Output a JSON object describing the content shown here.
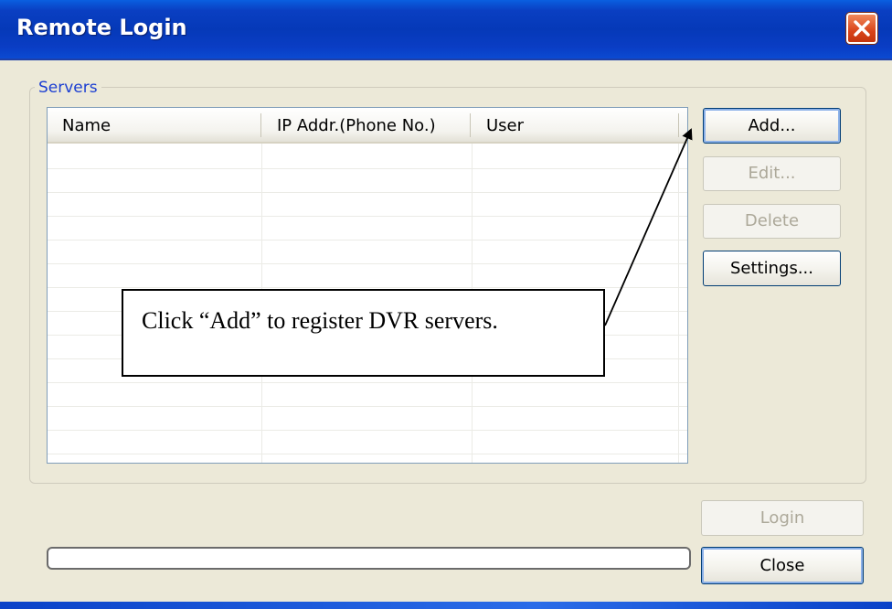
{
  "window": {
    "title": "Remote Login"
  },
  "servers": {
    "legend": "Servers",
    "columns": [
      "Name",
      "IP Addr.(Phone No.)",
      "User"
    ]
  },
  "buttons": {
    "add": "Add...",
    "edit": "Edit...",
    "delete": "Delete",
    "settings": "Settings...",
    "login": "Login",
    "close": "Close"
  },
  "callout": {
    "text": "Click “Add” to register DVR servers."
  },
  "icons": {
    "close": "close-icon"
  },
  "colors": {
    "titlebar": "#0539b8",
    "legend": "#1c3fd2",
    "close_button": "#d9441a"
  }
}
